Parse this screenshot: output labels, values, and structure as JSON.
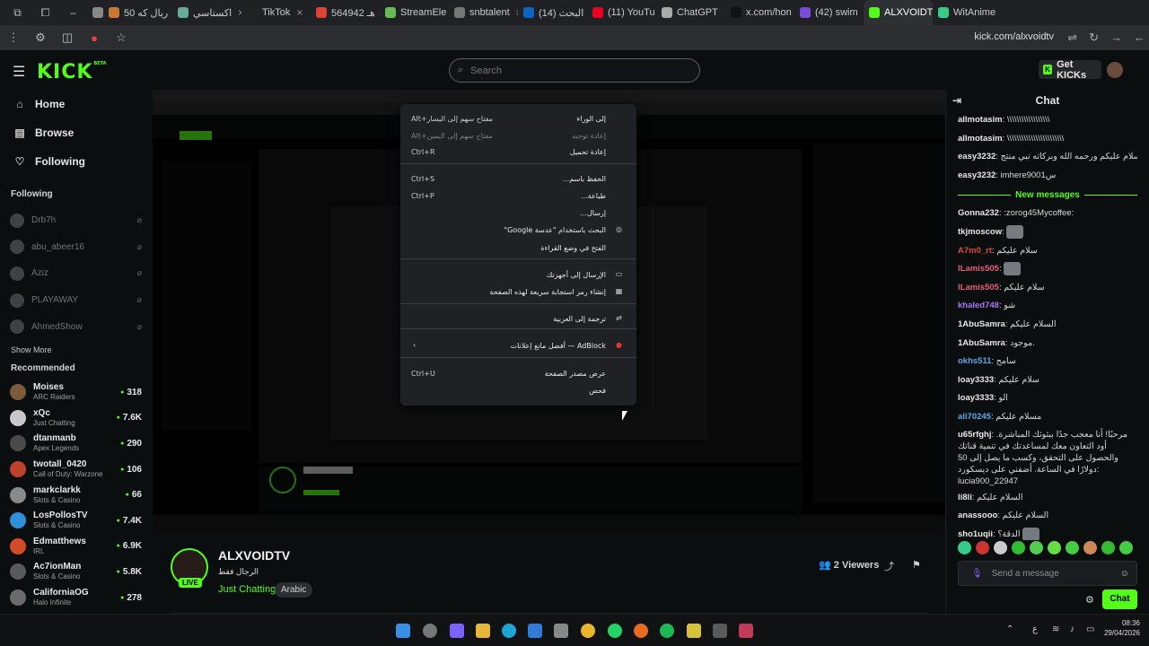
{
  "browser": {
    "tabs": [
      {
        "label": "",
        "color": "#888",
        "active": false
      },
      {
        "label": "50 ريال كه",
        "color": "#c73",
        "active": false
      },
      {
        "label": "اكستاسي",
        "color": "#6a9",
        "active": false
      },
      {
        "label": "TikTok",
        "color": "#222",
        "active": false
      },
      {
        "label": "564942 هـ",
        "color": "#d43",
        "active": false
      },
      {
        "label": "StreamEle",
        "color": "#6b5",
        "active": false
      },
      {
        "label": "snbtalent",
        "color": "#777",
        "active": false
      },
      {
        "label": "(14) البحث",
        "color": "#0a66c2",
        "active": false
      },
      {
        "label": "(11) YouTu",
        "color": "#e02",
        "active": false
      },
      {
        "label": "ChatGPT",
        "color": "#aaa",
        "active": false
      },
      {
        "label": "x.com/hon",
        "color": "#111",
        "active": false
      },
      {
        "label": "(42) swim",
        "color": "#7a4bd6",
        "active": false
      },
      {
        "label": "ALXVOIDT",
        "color": "#53fc18",
        "active": true
      },
      {
        "label": "WitAnime",
        "color": "#3c8",
        "active": false
      }
    ],
    "url": "kick.com/alxvoidtv"
  },
  "header": {
    "logo": "KICK",
    "logo_sup": "BETA",
    "search_placeholder": "Search",
    "get_kicks": "Get KICKs"
  },
  "sidebar": {
    "nav": [
      {
        "label": "Home",
        "icon": "⌂"
      },
      {
        "label": "Browse",
        "icon": "▤"
      },
      {
        "label": "Following",
        "icon": "♡"
      }
    ],
    "following_title": "Following",
    "following": [
      "Drb7h",
      "abu_abeer16",
      "Aziz",
      "PLAYAWAY",
      "AhmedShow"
    ],
    "show_more": "Show More",
    "recommended_title": "Recommended",
    "recommended": [
      {
        "name": "Moises",
        "cat": "ARC Raiders",
        "viewers": "318",
        "color": "#7d5a3c"
      },
      {
        "name": "xQc",
        "cat": "Just Chatting",
        "viewers": "7.6K",
        "color": "#c8c8c8"
      },
      {
        "name": "dtanmanb",
        "cat": "Apex Legends",
        "viewers": "290",
        "color": "#4a4a4a"
      },
      {
        "name": "twotall_0420",
        "cat": "Call of Duty: Warzone",
        "viewers": "106",
        "color": "#c0412c"
      },
      {
        "name": "markclarkk",
        "cat": "Slots & Casino",
        "viewers": "66",
        "color": "#8a8a8a"
      },
      {
        "name": "LosPollosTV",
        "cat": "Slots & Casino",
        "viewers": "7.4K",
        "color": "#2f8fd8"
      },
      {
        "name": "Edmatthews",
        "cat": "IRL",
        "viewers": "6.9K",
        "color": "#d34a2a"
      },
      {
        "name": "Ac7ionMan",
        "cat": "Slots & Casino",
        "viewers": "5.8K",
        "color": "#595959"
      },
      {
        "name": "CaliforniaOG",
        "cat": "Halo Infinite",
        "viewers": "278",
        "color": "#6b6b6b"
      }
    ]
  },
  "context_menu": [
    {
      "label": "إلى الوراء",
      "shortcut": "Alt+مفتاح سهم إلى اليسار",
      "disabled": false
    },
    {
      "label": "إعادة توجيه",
      "shortcut": "Alt+مفتاح سهم إلى اليمين",
      "disabled": true
    },
    {
      "label": "إعادة تحميل",
      "shortcut": "Ctrl+R",
      "disabled": false
    },
    {
      "label": "الحفظ باسم...",
      "shortcut": "Ctrl+S",
      "disabled": false
    },
    {
      "label": "طباعة...",
      "shortcut": "Ctrl+P",
      "disabled": false
    },
    {
      "label": "إرسال...",
      "shortcut": "",
      "disabled": false
    },
    {
      "label": "البحث باستخدام \"عدسة Google\"",
      "shortcut": "",
      "disabled": false,
      "icon": "◎"
    },
    {
      "label": "الفتح في وضع القراءة",
      "shortcut": "",
      "disabled": false
    },
    {
      "label": "الإرسال إلى أجهزتك",
      "shortcut": "",
      "disabled": false,
      "icon": "▭"
    },
    {
      "label": "إنشاء رمز استجابة سريعة لهذه الصفحة",
      "shortcut": "",
      "disabled": false,
      "icon": "▦"
    },
    {
      "label": "ترجمة إلى العربية",
      "shortcut": "",
      "disabled": false,
      "icon": "⇄"
    },
    {
      "label": "AdBlock — أفضل مانع إعلانات",
      "shortcut": "",
      "disabled": false,
      "icon": "●",
      "submenu": true
    },
    {
      "label": "عرض مصدر الصفحة",
      "shortcut": "Ctrl+U",
      "disabled": false
    },
    {
      "label": "فحص",
      "shortcut": "",
      "disabled": false
    }
  ],
  "stream": {
    "channel": "ALXVOIDTV",
    "subtitle": "الرجال فقط",
    "category": "Just Chatting",
    "tag": "Arabic",
    "live": "LIVE",
    "viewers": "2 Viewers"
  },
  "chat": {
    "title": "Chat",
    "messages": [
      {
        "user": "allmotasim",
        "color": "#e8e8e8",
        "text": ": \\\\\\\\\\\\\\\\\\\\\\\\\\\\\\\\\\\\"
      },
      {
        "user": "allmotasim",
        "color": "#e8e8e8",
        "text": ": \\\\\\\\\\\\\\\\\\\\\\\\\\\\\\\\\\\\\\\\\\\\\\\\"
      },
      {
        "user": "easy3232",
        "color": "#e8e8e8",
        "text": ": السلام عليكم ورحمه الله وبركاته نبي منتج"
      },
      {
        "user": "easy3232",
        "color": "#e8e8e8",
        "text": ": imhere9001س"
      }
    ],
    "new_messages": "New messages",
    "messages2": [
      {
        "user": "Gonna232",
        "color": "#e8e8e8",
        "text": ": :zorog45Mycoffee:",
        "emote": false
      },
      {
        "user": "tkjmoscow",
        "color": "#e8e8e8",
        "text": ":",
        "emote": true
      },
      {
        "user": "A7m0_rt",
        "color": "#e0483e",
        "text": ": سلام عليكم",
        "emote": false
      },
      {
        "user": "lLamis505",
        "color": "#e55e78",
        "text": ":",
        "emote": true
      },
      {
        "user": "lLamis505",
        "color": "#e55e78",
        "text": ": سلام عليكم",
        "emote": false
      },
      {
        "user": "khaled748",
        "color": "#a877f2",
        "text": ": شو",
        "emote": false
      },
      {
        "user": "1AbuSamra",
        "color": "#e8e8e8",
        "text": ": السلام عليكم",
        "emote": false
      },
      {
        "user": "1AbuSamra",
        "color": "#e8e8e8",
        "text": ": موجود.",
        "emote": false
      },
      {
        "user": "okhs511",
        "color": "#5aa8e8",
        "text": ": سامح",
        "emote": false
      },
      {
        "user": "loay3333",
        "color": "#e8e8e8",
        "text": ": سلام عليكم",
        "emote": false
      },
      {
        "user": "loay3333",
        "color": "#e8e8e8",
        "text": ": الو",
        "emote": false
      },
      {
        "user": "ali70245",
        "color": "#5aa8e8",
        "text": ": مسلام عليكم",
        "emote": false
      }
    ],
    "long_message": {
      "user": "u65rfghj",
      "color": "#e8e8e8",
      "text": ": مرحبًا! أنا معجب جدًا ببثوثك المباشرة. أود التعاون معك لمساعدتك في تنمية قناتك والحصول على التحقق، وكسب ما يصل إلى 50 دولارًا في الساعة. أضفني على ديسكورد: lucia900_22947"
    },
    "messages3": [
      {
        "user": "li8li",
        "color": "#e8e8e8",
        "text": ": السلام عليكم",
        "emote": false
      },
      {
        "user": "anassooo",
        "color": "#e8e8e8",
        "text": ": السلام عليكم",
        "emote": false
      },
      {
        "user": "sho1uqii",
        "color": "#e8e8e8",
        "text": ": الدقة؟",
        "emote": true
      }
    ],
    "input_placeholder": "Send a message",
    "send": "Chat"
  },
  "taskbar": {
    "time": "08:36",
    "date": "29/04/2026",
    "lang": "ع"
  }
}
